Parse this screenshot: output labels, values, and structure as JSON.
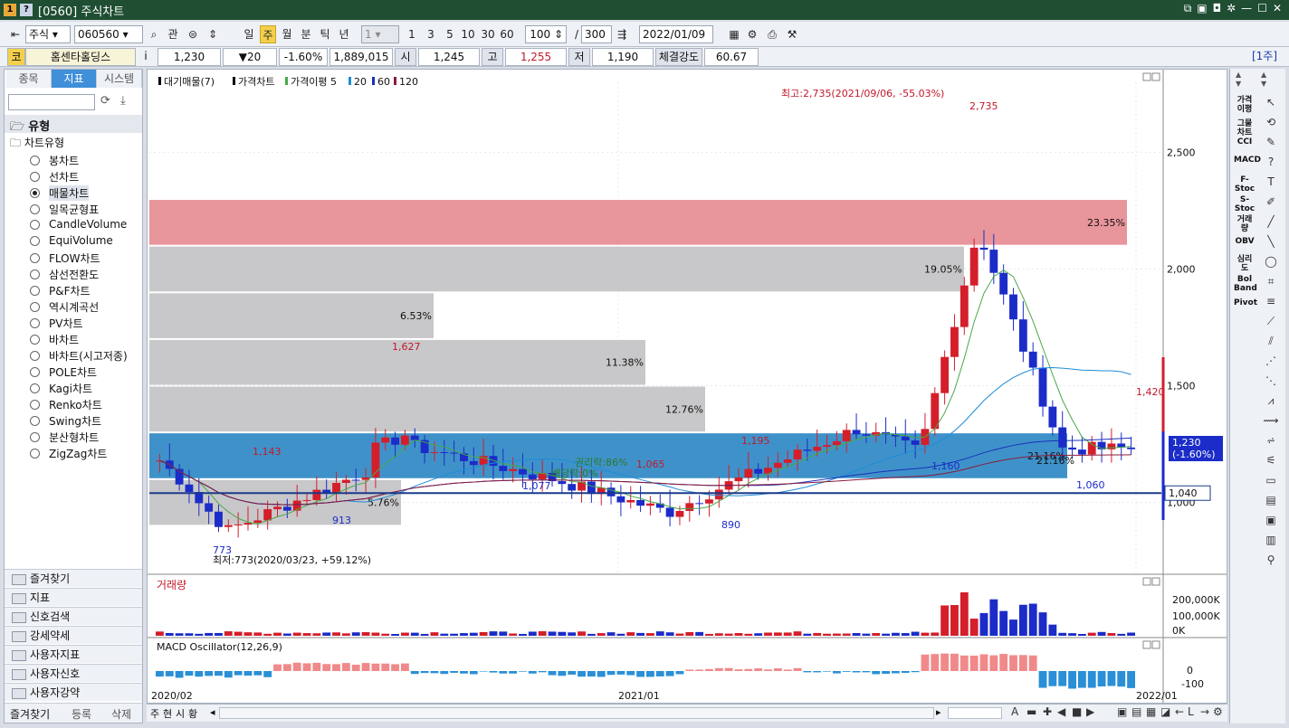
{
  "window": {
    "title": "[0560] 주식차트",
    "icon1": "1",
    "icon2": "?"
  },
  "toolbar": {
    "market": "주식",
    "code": "060560",
    "search_btn": "관",
    "periods": [
      "일",
      "주",
      "월",
      "분",
      "틱",
      "년"
    ],
    "selected_period": "주",
    "interval": "1",
    "quick_intervals": [
      "1",
      "3",
      "5",
      "10",
      "30",
      "60"
    ],
    "zoom_value": "100",
    "zoom_total": "300",
    "date": "2022/01/09"
  },
  "quote": {
    "market_badge": "코",
    "name": "홈센타홀딩스",
    "info_btn": "i",
    "price": "1,230",
    "change": "▼20",
    "change_pct": "-1.60%",
    "volume": "1,889,015",
    "open_label": "시",
    "open": "1,245",
    "high_label": "고",
    "high": "1,255",
    "low_label": "저",
    "low": "1,190",
    "strength_label": "체결강도",
    "strength": "60.67",
    "period_badge": "[1주]"
  },
  "left_panel": {
    "tabs": [
      "종목",
      "지표",
      "시스템"
    ],
    "selected_tab": "지표",
    "search_placeholder": "",
    "folder_type": "유형",
    "subfolder": "차트유형",
    "chart_types": [
      "봉차트",
      "선차트",
      "매물차트",
      "일목균형표",
      "CandleVolume",
      "EquiVolume",
      "FLOW차트",
      "삼선전환도",
      "P&F차트",
      "역시계곡선",
      "PV차트",
      "바차트",
      "바차트(시고저종)",
      "POLE차트",
      "Kagi차트",
      "Renko차트",
      "Swing차트",
      "분산형차트",
      "ZigZag차트"
    ],
    "selected_type": "매물차트",
    "folders": [
      "즐겨찾기",
      "지표",
      "신호검색",
      "강세약세",
      "사용자지표",
      "사용자신호",
      "사용자강약"
    ],
    "bottom_tabs": [
      "즐겨찾기",
      "등록",
      "삭제"
    ]
  },
  "chart": {
    "legend": [
      "대기매물(7)",
      "가격차트",
      "가격이평 5",
      "20",
      "60",
      "120"
    ],
    "legend_colors": [
      "#000000",
      "#000000",
      "#4aa84a",
      "#1e8cd8",
      "#1a2fbf",
      "#8b1a3a"
    ],
    "y_ticks": [
      "2,500",
      "2,000",
      "1,500",
      "1,000"
    ],
    "x_labels": [
      "2020/02",
      "2021/01",
      "2022/01"
    ],
    "high_note": "최고:2,735(2021/09/06, -55.03%)",
    "low_note": "최저:773(2020/03/23, +59.12%)",
    "annotations": [
      "2,735",
      "1,627",
      "1,420",
      "1,143",
      "1,195",
      "1,077",
      "1,065",
      "1,160",
      "1,060",
      "913",
      "890",
      "773"
    ],
    "right_tag_price": "1,230",
    "right_tag_pct": "(-1.60%)",
    "right_tag_level": "1,040",
    "right_ann": "21.16%",
    "kwon_note": "권리락:86%",
    "bae_note": "배당락:0%",
    "volume_title": "거래량",
    "volume_ticks": [
      "200,000K",
      "100,000K",
      "0K"
    ],
    "macd_title": "MACD Oscillator(12,26,9)",
    "macd_ticks": [
      "0",
      "-100"
    ]
  },
  "chart_data": {
    "type": "bar",
    "title": "",
    "volume_profile": [
      {
        "range": "2,100-2,300",
        "pct": "23.35%"
      },
      {
        "range": "1,900-2,100",
        "pct": "19.05%"
      },
      {
        "range": "1,700-1,900",
        "pct": "6.53%"
      },
      {
        "range": "1,500-1,700",
        "pct": "11.38%"
      },
      {
        "range": "1,300-1,500",
        "pct": "12.76%"
      },
      {
        "range": "1,100-1,300",
        "pct": "21.16%"
      },
      {
        "range": "900-1,100",
        "pct": "5.76%"
      }
    ],
    "ylim": [
      700,
      2800
    ],
    "price_high": 2735,
    "price_low": 773,
    "last_price": 1230
  },
  "right_indicators": [
    "가격이평",
    "그물차트",
    "CCI",
    "MACD",
    "F-Stoc",
    "S-Stoc",
    "거래량",
    "OBV",
    "심리도",
    "Bol Band",
    "Pivot"
  ],
  "bottom_bar": [
    "주",
    "현",
    "시",
    "황"
  ]
}
